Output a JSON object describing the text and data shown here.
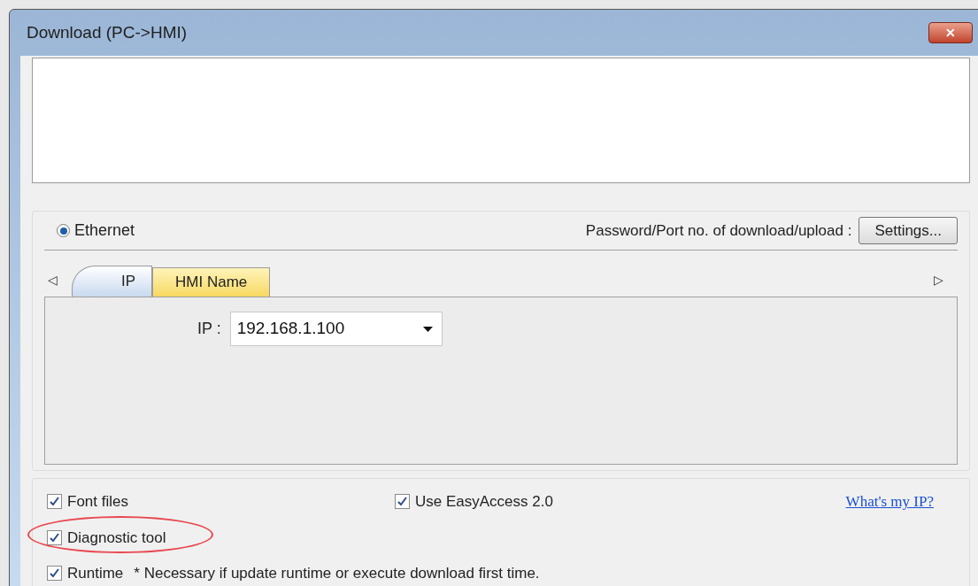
{
  "window": {
    "title": "Download (PC->HMI)",
    "close": "✕"
  },
  "connection": {
    "options": [
      {
        "label": "Ethernet",
        "selected": true
      }
    ],
    "password_label": "Password/Port no. of download/upload :",
    "settings_button": "Settings..."
  },
  "tabs": {
    "scroll_left": "◁",
    "scroll_right": "▷",
    "items": [
      {
        "label": "IP",
        "selected": true
      },
      {
        "label": "HMI Name",
        "selected": false
      }
    ]
  },
  "ip": {
    "label": "IP :",
    "value": "192.168.1.100"
  },
  "options": [
    {
      "label": "Font files",
      "checked": true,
      "highlighted": false
    },
    {
      "label": "Use EasyAccess 2.0",
      "checked": true,
      "highlighted": false
    },
    {
      "label": "Diagnostic tool",
      "checked": true,
      "highlighted": true
    },
    {
      "label": "Runtime",
      "checked": true,
      "highlighted": false
    }
  ],
  "link": "What's my IP?",
  "note": "* Necessary if update runtime or execute download first time."
}
